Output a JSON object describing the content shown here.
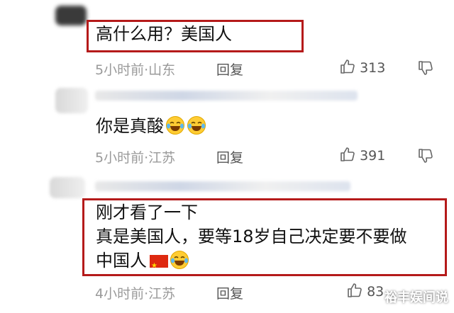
{
  "comments": [
    {
      "text": "高什么用？美国人",
      "time": "5小时前",
      "location": "山东",
      "reply_label": "回复",
      "likes": "313",
      "highlighted": true
    },
    {
      "text": "你是真酸",
      "time": "5小时前",
      "location": "江苏",
      "reply_label": "回复",
      "likes": "391",
      "highlighted": false,
      "emojis": [
        "laugh-cry-icon",
        "laugh-cry-icon"
      ]
    },
    {
      "lines": [
        "刚才看了一下",
        "真是美国人，要等18岁自己决定要不要做",
        "中国人"
      ],
      "time": "4小时前",
      "location": "江苏",
      "reply_label": "回复",
      "likes": "83",
      "highlighted": true,
      "emojis": [
        "china-flag-icon",
        "laugh-cry-icon"
      ]
    }
  ],
  "meta_separator": "·",
  "watermark": "裕丰娱间说",
  "colors": {
    "highlight_border": "#b51a1a",
    "meta_text": "#9a9a9a",
    "background": "#ffffff"
  }
}
